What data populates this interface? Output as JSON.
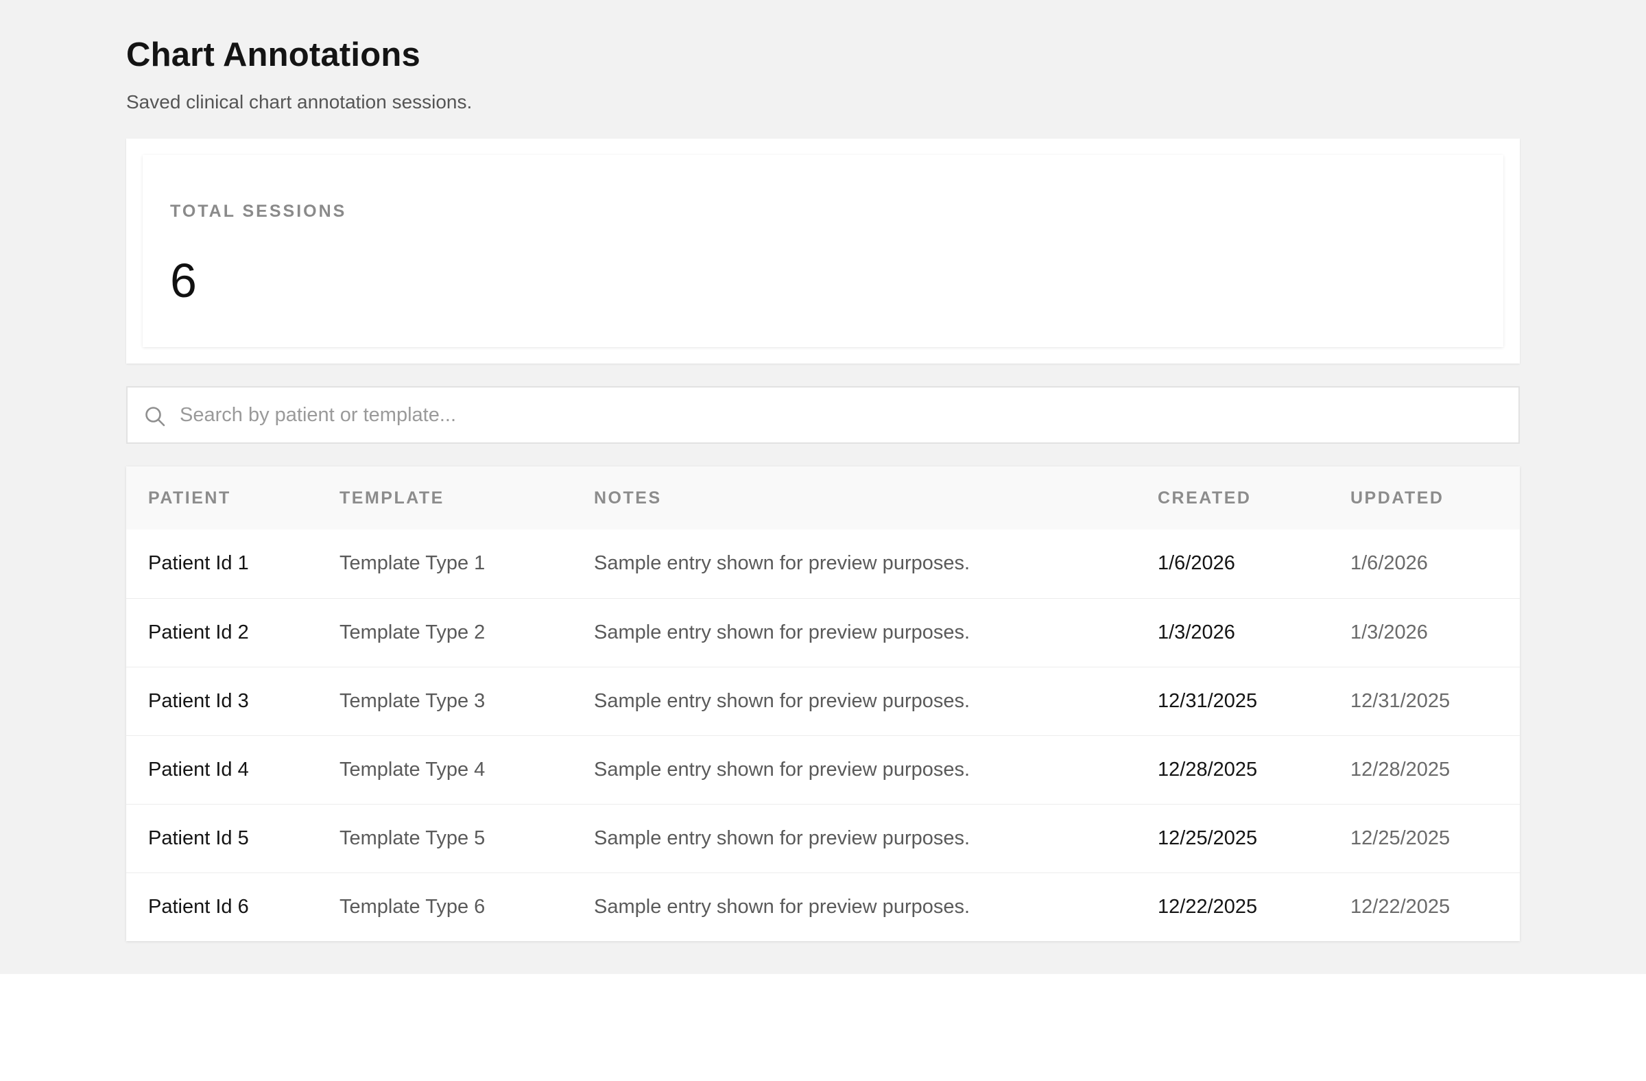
{
  "header": {
    "title": "Chart Annotations",
    "subtitle": "Saved clinical chart annotation sessions."
  },
  "stats": {
    "total_label": "TOTAL SESSIONS",
    "total_value": "6"
  },
  "search": {
    "placeholder": "Search by patient or template...",
    "value": "",
    "icon": "search-icon"
  },
  "table": {
    "columns": [
      "PATIENT",
      "TEMPLATE",
      "NOTES",
      "CREATED",
      "UPDATED"
    ],
    "rows": [
      {
        "patient": "Patient Id 1",
        "template": "Template Type 1",
        "notes": "Sample entry shown for preview purposes.",
        "created": "1/6/2026",
        "updated": "1/6/2026"
      },
      {
        "patient": "Patient Id 2",
        "template": "Template Type 2",
        "notes": "Sample entry shown for preview purposes.",
        "created": "1/3/2026",
        "updated": "1/3/2026"
      },
      {
        "patient": "Patient Id 3",
        "template": "Template Type 3",
        "notes": "Sample entry shown for preview purposes.",
        "created": "12/31/2025",
        "updated": "12/31/2025"
      },
      {
        "patient": "Patient Id 4",
        "template": "Template Type 4",
        "notes": "Sample entry shown for preview purposes.",
        "created": "12/28/2025",
        "updated": "12/28/2025"
      },
      {
        "patient": "Patient Id 5",
        "template": "Template Type 5",
        "notes": "Sample entry shown for preview purposes.",
        "created": "12/25/2025",
        "updated": "12/25/2025"
      },
      {
        "patient": "Patient Id 6",
        "template": "Template Type 6",
        "notes": "Sample entry shown for preview purposes.",
        "created": "12/22/2025",
        "updated": "12/22/2025"
      }
    ]
  },
  "colors": {
    "page_background": "#f2f2f2",
    "card_background": "#ffffff",
    "header_row_background": "#f9f9f9",
    "title_text": "#141414",
    "muted_text": "#8c8c8c"
  }
}
